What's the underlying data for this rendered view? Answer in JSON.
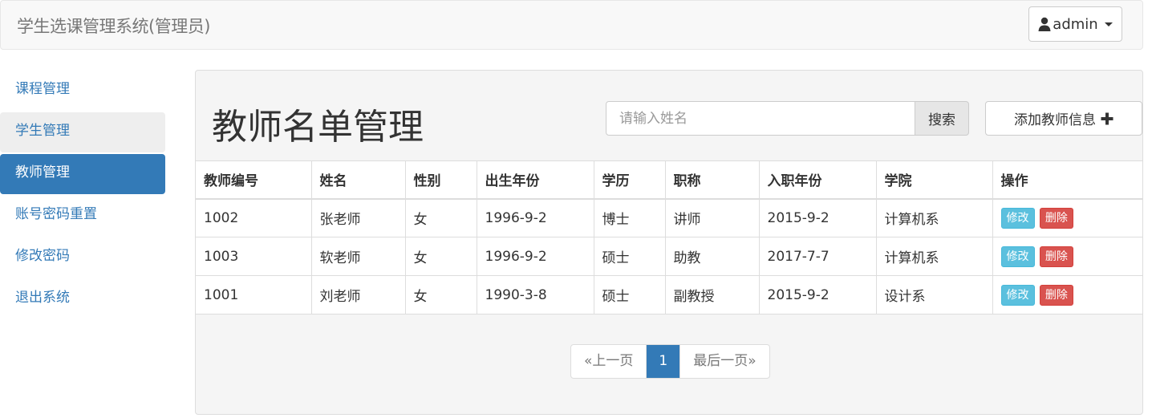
{
  "navbar": {
    "brand": "学生选课管理系统(管理员)",
    "user_label": "admin"
  },
  "sidebar": {
    "items": [
      {
        "label": "课程管理"
      },
      {
        "label": "学生管理"
      },
      {
        "label": "教师管理"
      },
      {
        "label": "账号密码重置"
      },
      {
        "label": "修改密码"
      },
      {
        "label": "退出系统"
      }
    ]
  },
  "main": {
    "title": "教师名单管理",
    "search_placeholder": "请输入姓名",
    "search_button": "搜索",
    "add_button": "添加教师信息"
  },
  "table": {
    "columns": [
      "教师编号",
      "姓名",
      "性别",
      "出生年份",
      "学历",
      "职称",
      "入职年份",
      "学院",
      "操作"
    ],
    "rows": [
      [
        "1002",
        "张老师",
        "女",
        "1996-9-2",
        "博士",
        "讲师",
        "2015-9-2",
        "计算机系"
      ],
      [
        "1003",
        "软老师",
        "女",
        "1996-9-2",
        "硕士",
        "助教",
        "2017-7-7",
        "计算机系"
      ],
      [
        "1001",
        "刘老师",
        "女",
        "1990-3-8",
        "硕士",
        "副教授",
        "2015-9-2",
        "设计系"
      ]
    ],
    "edit_label": "修改",
    "delete_label": "删除"
  },
  "pagination": {
    "prev": "«上一页",
    "current": "1",
    "last": "最后一页»"
  },
  "colors": {
    "primary": "#337ab7",
    "info": "#5bc0de",
    "danger": "#d9534f"
  }
}
